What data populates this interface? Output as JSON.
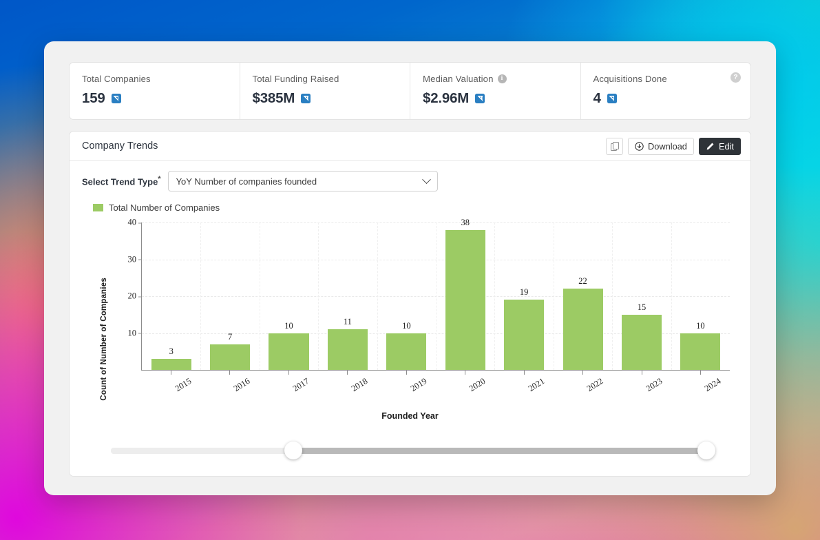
{
  "kpis": [
    {
      "label": "Total Companies",
      "value": "159",
      "icon": "external-link-icon",
      "has_info": false,
      "has_help": false
    },
    {
      "label": "Total Funding Raised",
      "value": "$385M",
      "icon": "external-link-icon",
      "has_info": false,
      "has_help": false
    },
    {
      "label": "Median Valuation",
      "value": "$2.96M",
      "icon": "external-link-icon",
      "has_info": true,
      "has_help": false
    },
    {
      "label": "Acquisitions Done",
      "value": "4",
      "icon": "external-link-icon",
      "has_info": false,
      "has_help": true
    }
  ],
  "info_glyph": "i",
  "help_glyph": "?",
  "panel": {
    "title": "Company Trends",
    "copy_button_name": "copy-icon",
    "download_label": "Download",
    "edit_label": "Edit"
  },
  "control": {
    "label": "Select Trend Type",
    "required_marker": "*",
    "selected_option": "YoY Number of companies founded"
  },
  "legend": {
    "series_label": "Total Number of Companies",
    "swatch_color": "#9ccb64"
  },
  "slider": {
    "left_percent": 30.5,
    "right_percent": 99.5
  },
  "chart_data": {
    "type": "bar",
    "title": "",
    "categories": [
      "2015",
      "2016",
      "2017",
      "2018",
      "2019",
      "2020",
      "2021",
      "2022",
      "2023",
      "2024"
    ],
    "values": [
      3,
      7,
      10,
      11,
      10,
      38,
      19,
      22,
      15,
      10
    ],
    "series": [
      {
        "name": "Total Number of Companies",
        "values": [
          3,
          7,
          10,
          11,
          10,
          38,
          19,
          22,
          15,
          10
        ]
      }
    ],
    "xlabel": "Founded Year",
    "ylabel": "Count of Number of Companies",
    "ylim": [
      0,
      40
    ],
    "yticks": [
      10,
      20,
      30,
      40
    ],
    "grid": true,
    "legend_position": "top-left",
    "bar_color": "#9ccb64"
  }
}
